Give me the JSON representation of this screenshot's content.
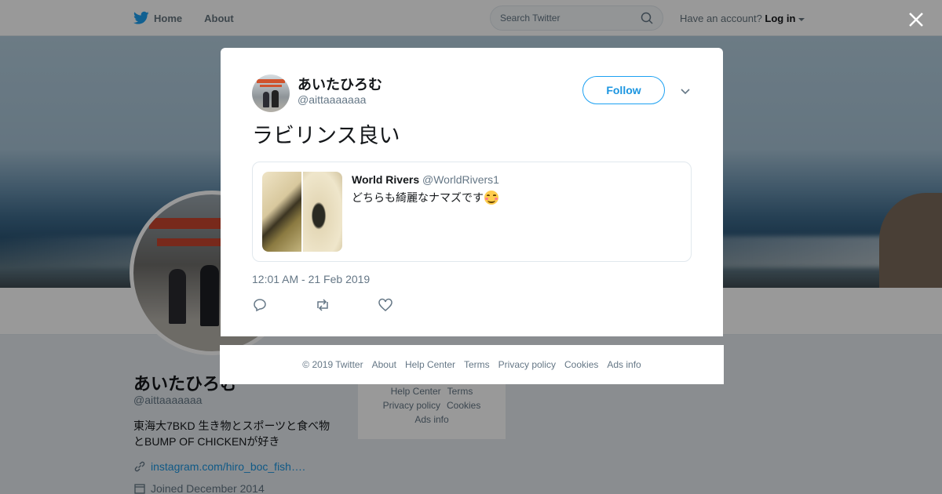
{
  "nav": {
    "home_label": "Home",
    "about_label": "About",
    "search_placeholder": "Search Twitter",
    "account_prompt": "Have an account?",
    "login_label": "Log in"
  },
  "profile": {
    "name": "あいたひろむ",
    "handle": "@aittaaaaaaa",
    "bio": "東海大7BKD 生き物とスポーツと食べ物とBUMP OF CHICKENが好き",
    "link": "instagram.com/hiro_boc_fish….",
    "joined": "Joined December 2014"
  },
  "side_footer": {
    "help": "Help Center",
    "terms": "Terms",
    "privacy": "Privacy policy",
    "cookies": "Cookies",
    "ads": "Ads info"
  },
  "tweet": {
    "author_name": "あいたひろむ",
    "author_handle": "@aittaaaaaaa",
    "follow_label": "Follow",
    "text": "ラビリンス良い",
    "quoted": {
      "name": "World Rivers",
      "handle": "@WorldRivers1",
      "text": "どちらも綺麗なナマズです",
      "emoji": "smiling-face-with-smiling-eyes"
    },
    "timestamp": "12:01 AM - 21 Feb 2019"
  },
  "modal_footer": {
    "copyright": "© 2019 Twitter",
    "about": "About",
    "help": "Help Center",
    "terms": "Terms",
    "privacy": "Privacy policy",
    "cookies": "Cookies",
    "ads": "Ads info"
  },
  "colors": {
    "brand_blue": "#1da1f2",
    "link_blue": "#1b95e0",
    "text_primary": "#14171a",
    "text_secondary": "#657786"
  }
}
